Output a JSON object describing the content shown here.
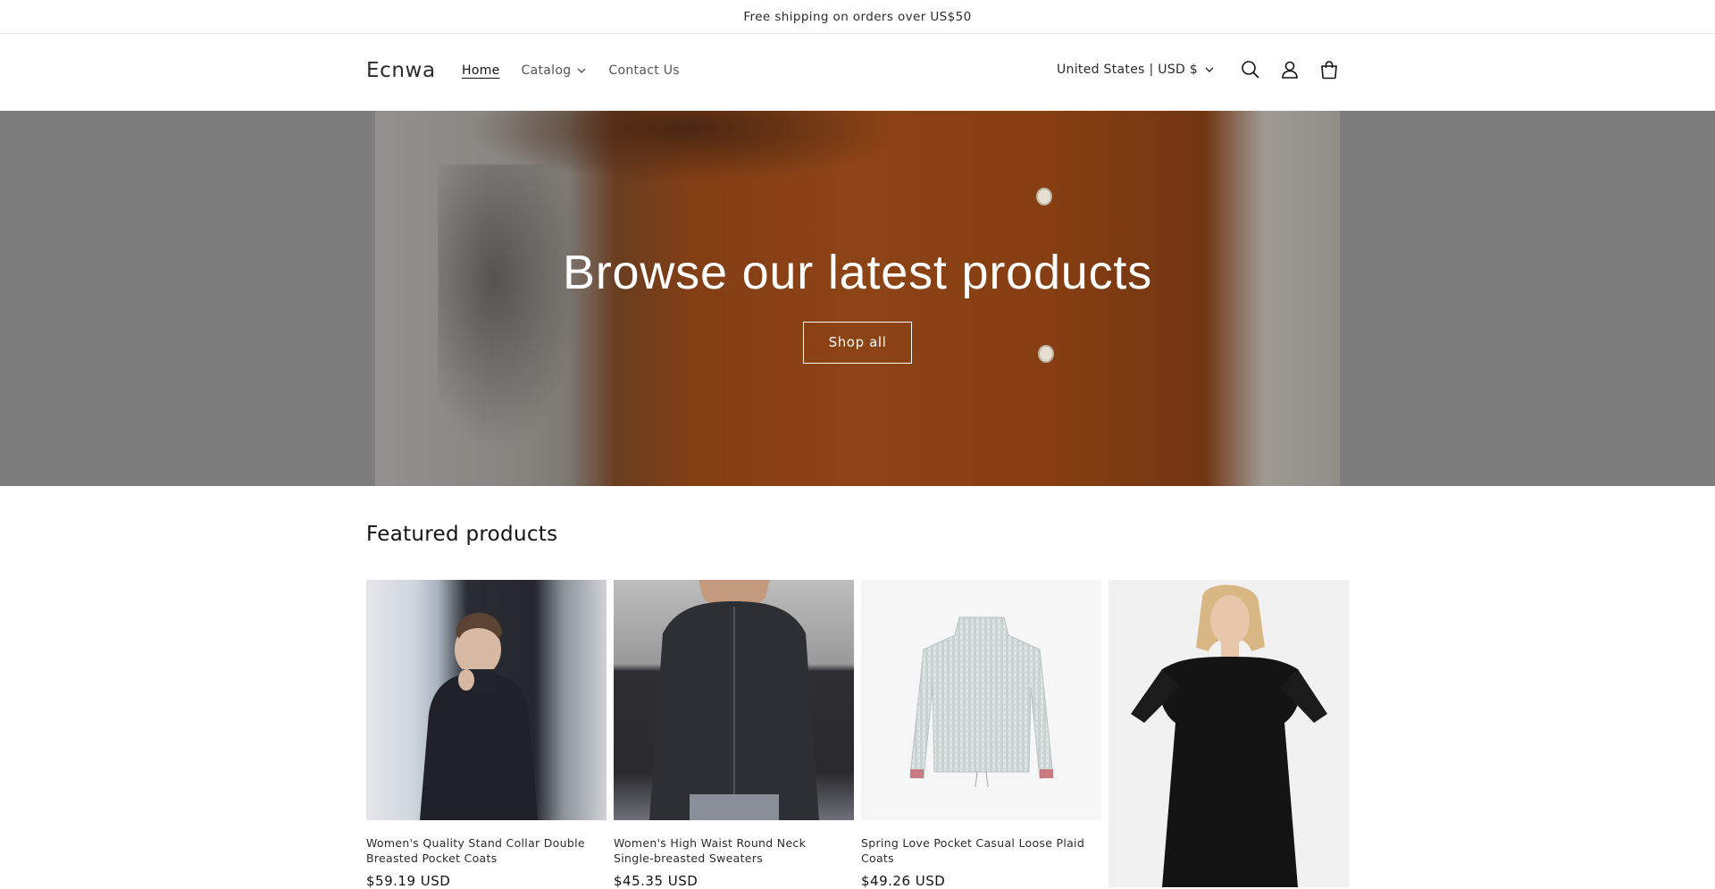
{
  "announcement": {
    "text": "Free shipping on orders over US$50"
  },
  "header": {
    "logo": "Ecnwa",
    "nav": [
      {
        "label": "Home",
        "active": true
      },
      {
        "label": "Catalog",
        "has_dropdown": true
      },
      {
        "label": "Contact Us"
      }
    ],
    "country_selector": "United States | USD $",
    "icons": [
      "search-icon",
      "account-icon",
      "cart-icon"
    ]
  },
  "hero": {
    "title": "Browse our latest products",
    "cta": "Shop all"
  },
  "featured": {
    "title": "Featured products",
    "products": [
      {
        "title": "Women's Quality Stand Collar Double Breasted Pocket Coats",
        "price": "$59.19 USD"
      },
      {
        "title": "Women's High Waist Round Neck Single-breasted Sweaters",
        "price": "$45.35 USD"
      },
      {
        "title": "Spring Love Pocket Casual Loose Plaid Coats",
        "price": "$49.26 USD"
      },
      {
        "title": "",
        "price": ""
      }
    ]
  },
  "colors": {
    "text": "#121212",
    "hero_overlay": "#7d7d7d",
    "accent_orange": "#c65c1b"
  }
}
